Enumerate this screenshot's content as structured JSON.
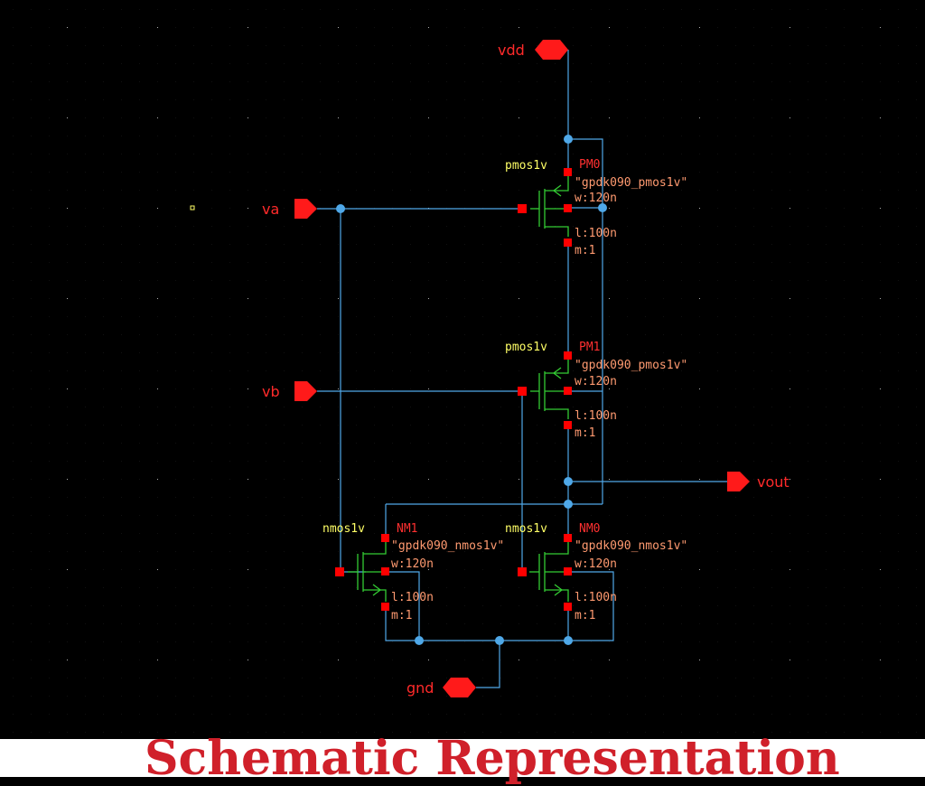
{
  "pins": {
    "vdd": "vdd",
    "va": "va",
    "vb": "vb",
    "vout": "vout",
    "gnd": "gnd"
  },
  "transistors": [
    {
      "id": "PM0",
      "cell": "pmos1v",
      "model": "\"gpdk090_pmos1v\"",
      "w": "w:120n",
      "l": "l:100n",
      "m": "m:1"
    },
    {
      "id": "PM1",
      "cell": "pmos1v",
      "model": "\"gpdk090_pmos1v\"",
      "w": "w:120n",
      "l": "l:100n",
      "m": "m:1"
    },
    {
      "id": "NM1",
      "cell": "nmos1v",
      "model": "\"gpdk090_nmos1v\"",
      "w": "w:120n",
      "l": "l:100n",
      "m": "m:1"
    },
    {
      "id": "NM0",
      "cell": "nmos1v",
      "model": "\"gpdk090_nmos1v\"",
      "w": "w:120n",
      "l": "l:100n",
      "m": "m:1"
    }
  ],
  "caption": "Schematic Representation",
  "colors": {
    "background": "#000000",
    "wire": "#4fa8e8",
    "pin": "#ff1a1a",
    "device": "#33cc33",
    "terminal": "#ff0000",
    "cell_label": "#ffff66",
    "param": "#ff9a70",
    "caption": "#d0202a"
  }
}
